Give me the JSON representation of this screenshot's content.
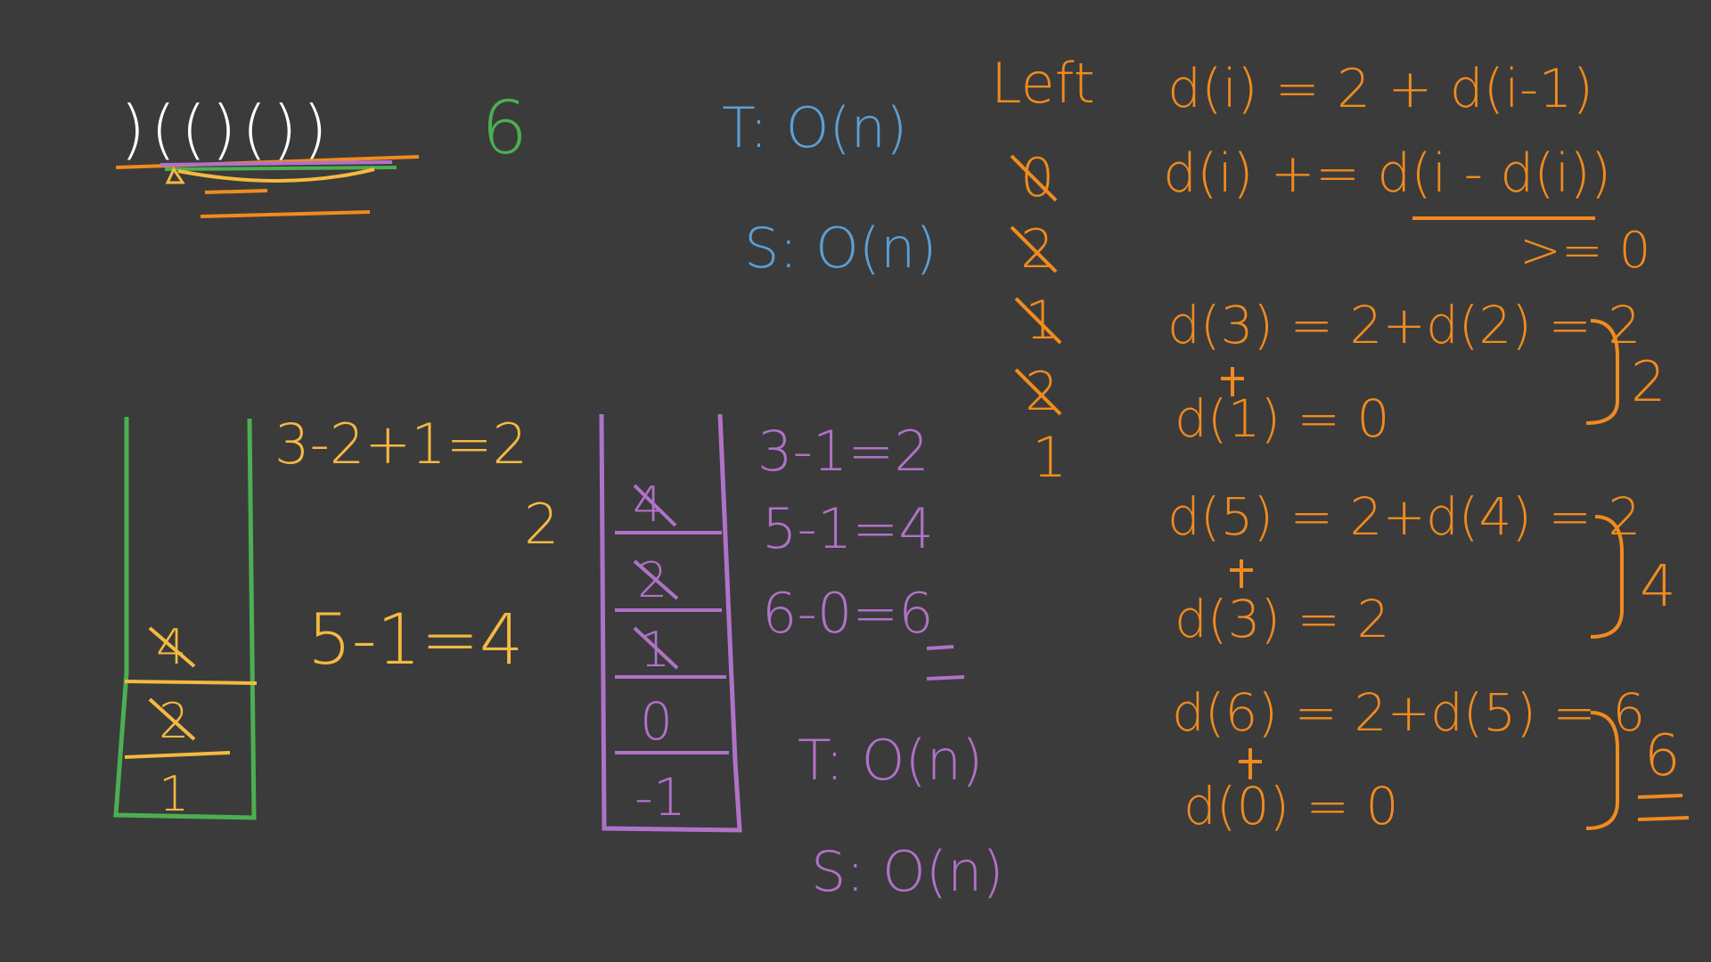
{
  "board": {
    "background": "#3b3b3b",
    "colors": {
      "white": "#ffffff",
      "green": "#4caf50",
      "blue": "#5aa0d6",
      "orange": "#f08b1f",
      "yellow": "#f5b942",
      "purple": "#b072c8"
    }
  },
  "problem": {
    "string": ")(()())",
    "answer": "6"
  },
  "complexity_top": {
    "time": "T: O(n)",
    "space": "S: O(n)"
  },
  "left_column": {
    "header": "Left",
    "values": [
      "0",
      "2",
      "1",
      "2",
      "1"
    ]
  },
  "recurrence": {
    "line1": "d(i) = 2 + d(i-1)",
    "line2": "d(i) += d(i - d(i))",
    "cond": ">= 0"
  },
  "examples": [
    {
      "main": "d(3) = 2+d(2) = 2",
      "sub": "d(1) = 0",
      "total": "2"
    },
    {
      "main": "d(5) = 2+d(4) = 2",
      "sub": "d(3) = 2",
      "total": "4"
    },
    {
      "main": "d(6) = 2+d(5) = 6",
      "sub": "d(0) = 0",
      "total": "6"
    }
  ],
  "green_stack": {
    "cells": [
      "4",
      "2",
      "1"
    ],
    "calc1": "3-2+1=2",
    "calc1_result": "2",
    "calc2": "5-1=4"
  },
  "purple_stack": {
    "cells": [
      "4",
      "2",
      "1",
      "0",
      "-1"
    ],
    "calcs": [
      "3-1=2",
      "5-1=4",
      "6-0=6"
    ],
    "time": "T: O(n)",
    "space": "S: O(n)"
  }
}
